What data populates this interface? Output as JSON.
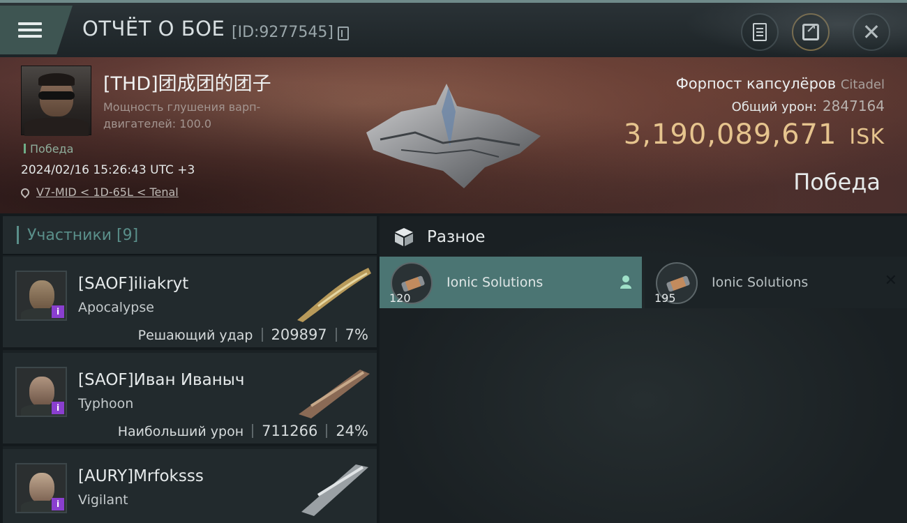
{
  "topbar": {
    "title": "ОТЧЁТ О БОЕ",
    "report_id": "[ID:9277545]"
  },
  "header": {
    "pilot_name": "[THD]团成团的团子",
    "attribute": "Мощность глушения варп-двигателей: 100.0",
    "result_label": "Победа",
    "datetime": "2024/02/16 15:26:43 UTC +3",
    "location": "V7-MID < 1D-65L < Tenal",
    "target_name": "Форпост капсулёров",
    "target_class": "Citadel",
    "total_damage_label": "Общий урон:",
    "total_damage_value": "2847164",
    "isk_value": "3,190,089,671",
    "isk_currency": "ISK",
    "result_big": "Победа"
  },
  "participants": {
    "title": "Участники [9]",
    "items": [
      {
        "name": "[SAOF]iliakryt",
        "ship": "Apocalypse",
        "role": "Решающий удар",
        "damage": "209897",
        "percent": "7%"
      },
      {
        "name": "[SAOF]Иван Иваныч",
        "ship": "Typhoon",
        "role": "Наибольший урон",
        "damage": "711266",
        "percent": "24%"
      },
      {
        "name": "[AURY]Mrfoksss",
        "ship": "Vigilant",
        "role": "",
        "damage": "",
        "percent": ""
      }
    ]
  },
  "misc": {
    "title": "Разное",
    "items": [
      {
        "name": "Ionic Solutions",
        "qty": "120",
        "selected": true
      },
      {
        "name": "Ionic Solutions",
        "qty": "195",
        "selected": false
      }
    ]
  },
  "colors": {
    "accent_teal": "#4b7573",
    "isk_gold": "#e6c48e",
    "badge_purple": "#8a3fcf"
  },
  "icons": [
    "menu-icon",
    "copy-icon",
    "document-icon",
    "share-icon",
    "close-icon",
    "location-pin-icon",
    "cube-icon",
    "user-icon",
    "x-icon"
  ]
}
